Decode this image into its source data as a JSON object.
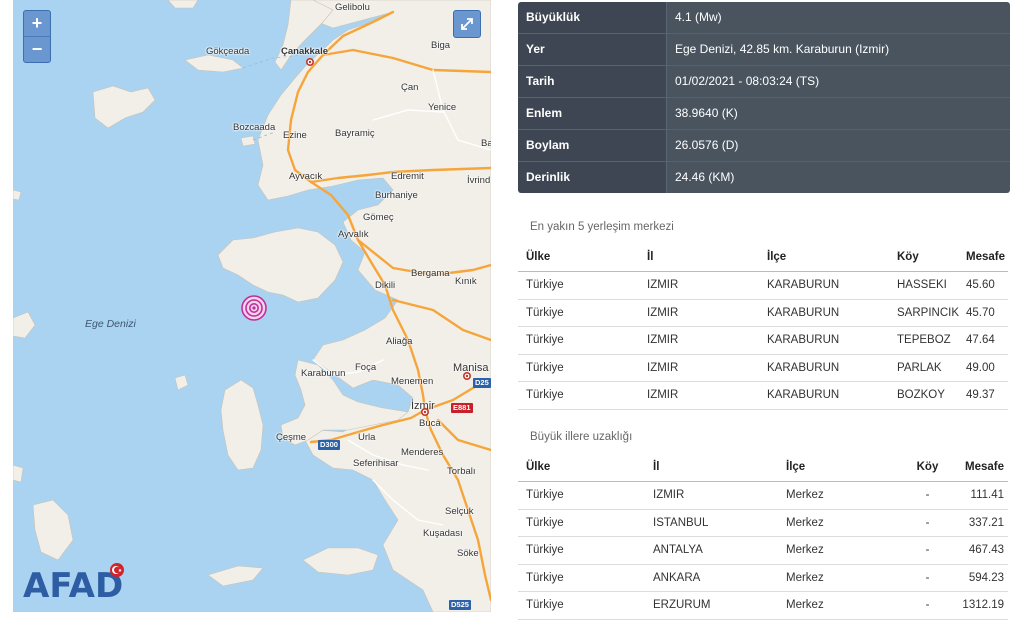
{
  "map": {
    "zoom_in": "+",
    "zoom_out": "−",
    "logo": "AFAD",
    "places": {
      "gelibolu": "Gelibolu",
      "gokceada": "Gökçeada",
      "canakkale": "Çanakkale",
      "biga": "Biga",
      "can": "Çan",
      "yenice": "Yenice",
      "bozcaada": "Bozcaada",
      "ezine": "Ezine",
      "bayramic": "Bayramiç",
      "ba": "Ba",
      "ayvacik": "Ayvacık",
      "edremit": "Edremit",
      "ivrind": "İvrind",
      "burhaniye": "Burhaniye",
      "gomec": "Gömeç",
      "ayvalik": "Ayvalık",
      "bergama": "Bergama",
      "kinik": "Kınık",
      "dikili": "Dikili",
      "ege_denizi": "Ege Denizi",
      "aliaga": "Aliağa",
      "manisa": "Manisa",
      "karaburun": "Karaburun",
      "foca": "Foça",
      "menemen": "Menemen",
      "izmir": "İzmir",
      "cesme": "Çeşme",
      "urla": "Urla",
      "buca": "Buca",
      "seferihisar": "Seferihisar",
      "menderes": "Menderes",
      "torbali": "Torbalı",
      "selcuk": "Selçuk",
      "kusadasi": "Kuşadası",
      "soke": "Söke"
    },
    "roads": {
      "d300": "D300",
      "e881": "E881",
      "d25": "D25",
      "d525": "D525"
    },
    "colors": {
      "sea": "#a9d3f1",
      "land": "#f2efe9",
      "highway": "#f6a53a",
      "marker": "#c0309a",
      "logo_blue": "#2e5da4",
      "logo_red": "#d2232a"
    }
  },
  "quake": {
    "rows": [
      {
        "label": "Büyüklük",
        "value": "4.1 (Mw)"
      },
      {
        "label": "Yer",
        "value": "Ege Denizi, 42.85 km. Karaburun (Izmir)"
      },
      {
        "label": "Tarih",
        "value": "01/02/2021 - 08:03:24 (TS)"
      },
      {
        "label": "Enlem",
        "value": "38.9640 (K)"
      },
      {
        "label": "Boylam",
        "value": "26.0576 (D)"
      },
      {
        "label": "Derinlik",
        "value": "24.46 (KM)"
      }
    ]
  },
  "nearest": {
    "title": "En yakın 5 yerleşim merkezi",
    "headers": [
      "Ülke",
      "İl",
      "İlçe",
      "Köy",
      "Mesafe"
    ],
    "rows": [
      [
        "Türkiye",
        "IZMIR",
        "KARABURUN",
        "HASSEKI",
        "45.60"
      ],
      [
        "Türkiye",
        "IZMIR",
        "KARABURUN",
        "SARPINCIK",
        "45.70"
      ],
      [
        "Türkiye",
        "IZMIR",
        "KARABURUN",
        "TEPEBOZ",
        "47.64"
      ],
      [
        "Türkiye",
        "IZMIR",
        "KARABURUN",
        "PARLAK",
        "49.00"
      ],
      [
        "Türkiye",
        "IZMIR",
        "KARABURUN",
        "BOZKOY",
        "49.37"
      ]
    ]
  },
  "cities": {
    "title": "Büyük illere uzaklığı",
    "headers": [
      "Ülke",
      "İl",
      "İlçe",
      "Köy",
      "Mesafe"
    ],
    "rows": [
      [
        "Türkiye",
        "IZMIR",
        "Merkez",
        "-",
        "111.41"
      ],
      [
        "Türkiye",
        "ISTANBUL",
        "Merkez",
        "-",
        "337.21"
      ],
      [
        "Türkiye",
        "ANTALYA",
        "Merkez",
        "-",
        "467.43"
      ],
      [
        "Türkiye",
        "ANKARA",
        "Merkez",
        "-",
        "594.23"
      ],
      [
        "Türkiye",
        "ERZURUM",
        "Merkez",
        "-",
        "1312.19"
      ]
    ]
  }
}
